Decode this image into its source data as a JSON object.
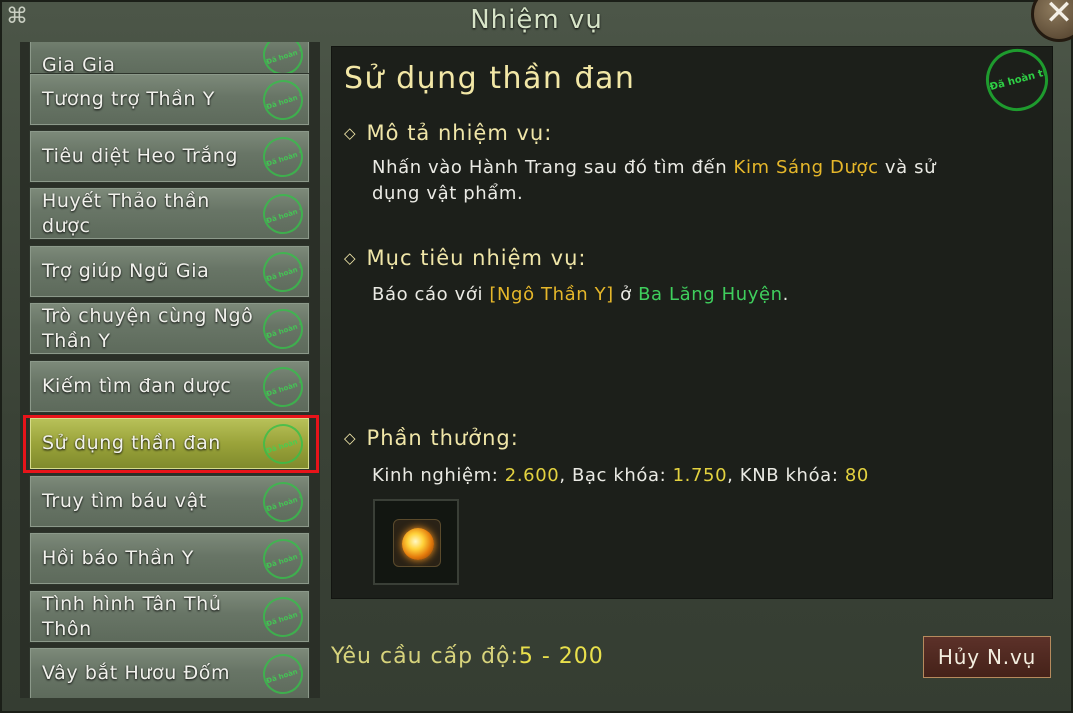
{
  "window": {
    "title": "Nhiệm vụ",
    "close_label": "✕",
    "corner_glyph": "⌘"
  },
  "quest_list": [
    {
      "name": "Gia Gia",
      "stamp": "Đã hoàn thành"
    },
    {
      "name": "Tương trợ Thần Y",
      "stamp": "Đã hoàn thành"
    },
    {
      "name": "Tiêu diệt Heo Trắng",
      "stamp": "Đã hoàn thành"
    },
    {
      "name": "Huyết Thảo thần dược",
      "stamp": "Đã hoàn thành"
    },
    {
      "name": "Trợ giúp Ngũ Gia",
      "stamp": "Đã hoàn thành"
    },
    {
      "name": "Trò chuyện cùng Ngô Thần Y",
      "stamp": "Đã hoàn thành"
    },
    {
      "name": "Kiếm tìm đan dược",
      "stamp": "Đã hoàn thành"
    },
    {
      "name": "Sử dụng thần đan",
      "stamp": "Đã hoàn thành"
    },
    {
      "name": "Truy tìm báu vật",
      "stamp": "Đã hoàn thành"
    },
    {
      "name": "Hồi báo Thần Y",
      "stamp": "Đã hoàn thành"
    },
    {
      "name": "Tình hình Tân Thủ Thôn",
      "stamp": "Đã hoàn thành"
    },
    {
      "name": "Vây bắt Hươu Đốm",
      "stamp": "Đã hoàn thành"
    }
  ],
  "selected_index": 7,
  "detail": {
    "title": "Sử dụng thần đan",
    "status_stamp": "Đã hoàn thành",
    "description": {
      "heading": "Mô tả nhiệm vụ:",
      "text_1": "Nhấn vào Hành Trang sau đó tìm đến ",
      "highlight": "Kim Sáng Dược",
      "text_2": " và sử",
      "text_3": "dụng vật phẩm."
    },
    "objective": {
      "heading": "Mục tiêu nhiệm vụ:",
      "text_1": "Báo cáo với ",
      "npc": "[Ngô Thần Y]",
      "text_2": " ở ",
      "location": "Ba Lăng Huyện",
      "text_3": "."
    },
    "reward": {
      "heading": "Phần thưởng:",
      "exp_label": "Kinh nghiệm: ",
      "exp_value": "2.600",
      "silver_label": ", Bạc khóa: ",
      "silver_value": "1.750",
      "knb_label": ", KNB khóa: ",
      "knb_value": "80",
      "item_icon": "fire-orb-icon"
    }
  },
  "footer": {
    "level_label": "Yêu cầu cấp độ:",
    "level_value": "5 - 200",
    "cancel_label": "Hủy N.vụ"
  },
  "colors": {
    "accent_gold": "#e6b72a",
    "location_green": "#3fcf5d",
    "selection_outline": "#e8141a"
  }
}
